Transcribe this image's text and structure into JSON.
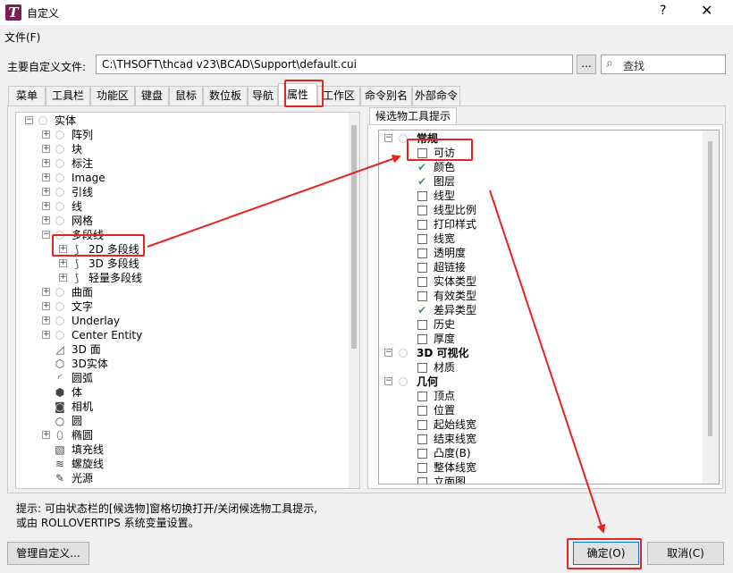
{
  "window": {
    "title": "自定义",
    "help": "?",
    "close": "✕"
  },
  "menu": {
    "file": "文件(F)"
  },
  "path": {
    "label": "主要自定义文件:",
    "value": "C:\\THSOFT\\thcad v23\\BCAD\\Support\\default.cui",
    "browse": "...",
    "search_placeholder": "查找"
  },
  "tabs": [
    "菜单",
    "工具栏",
    "功能区",
    "键盘",
    "鼠标",
    "数位板",
    "导航",
    "属性",
    "工作区",
    "命令别名",
    "外部命令"
  ],
  "active_tab": "属性",
  "left_tree": [
    {
      "label": "实体",
      "expander": "-",
      "icon": "circle"
    },
    {
      "label": "阵列",
      "expander": "+",
      "icon": "circle"
    },
    {
      "label": "块",
      "expander": "+",
      "icon": "circle"
    },
    {
      "label": "标注",
      "expander": "+",
      "icon": "circle"
    },
    {
      "label": "Image",
      "expander": "+",
      "icon": "circle"
    },
    {
      "label": "引线",
      "expander": "+",
      "icon": "circle"
    },
    {
      "label": "线",
      "expander": "+",
      "icon": "circle"
    },
    {
      "label": "网格",
      "expander": "+",
      "icon": "circle"
    },
    {
      "label": "多段线",
      "expander": "-",
      "icon": "circle"
    },
    {
      "label": "2D 多段线",
      "expander": "+",
      "icon": "polyline-icon"
    },
    {
      "label": "3D 多段线",
      "expander": "+",
      "icon": "polyline-icon"
    },
    {
      "label": "轻量多段线",
      "expander": "+",
      "icon": "polyline-icon"
    },
    {
      "label": "曲面",
      "expander": "+",
      "icon": "circle"
    },
    {
      "label": "文字",
      "expander": "+",
      "icon": "circle"
    },
    {
      "label": "Underlay",
      "expander": "+",
      "icon": "circle"
    },
    {
      "label": "Center Entity",
      "expander": "+",
      "icon": "circle"
    },
    {
      "label": "3D 面",
      "expander": "",
      "icon": "3dface-icon"
    },
    {
      "label": "3D实体",
      "expander": "",
      "icon": "3dsolid-icon"
    },
    {
      "label": "圆弧",
      "expander": "",
      "icon": "arc-icon"
    },
    {
      "label": "体",
      "expander": "",
      "icon": "body-icon"
    },
    {
      "label": "相机",
      "expander": "",
      "icon": "camera-icon"
    },
    {
      "label": "圆",
      "expander": "",
      "icon": "circle-icon"
    },
    {
      "label": "椭圆",
      "expander": "+",
      "icon": "ellipse-icon"
    },
    {
      "label": "填充线",
      "expander": "",
      "icon": "hatch-icon"
    },
    {
      "label": "螺旋线",
      "expander": "",
      "icon": "helix-icon"
    },
    {
      "label": "光源",
      "expander": "",
      "icon": "light-icon"
    }
  ],
  "right_tab": "候选物工具提示",
  "right_tree": [
    {
      "label": "常规",
      "kind": "group"
    },
    {
      "label": "可访",
      "kind": "check",
      "checked": false
    },
    {
      "label": "颜色",
      "kind": "check",
      "checked": true
    },
    {
      "label": "图层",
      "kind": "check",
      "checked": true
    },
    {
      "label": "线型",
      "kind": "check",
      "checked": false
    },
    {
      "label": "线型比例",
      "kind": "check",
      "checked": false
    },
    {
      "label": "打印样式",
      "kind": "check",
      "checked": false
    },
    {
      "label": "线宽",
      "kind": "check",
      "checked": false
    },
    {
      "label": "透明度",
      "kind": "check",
      "checked": false
    },
    {
      "label": "超链接",
      "kind": "check",
      "checked": false
    },
    {
      "label": "实体类型",
      "kind": "check",
      "checked": false
    },
    {
      "label": "有效类型",
      "kind": "check",
      "checked": false
    },
    {
      "label": "差异类型",
      "kind": "check",
      "checked": true
    },
    {
      "label": "历史",
      "kind": "check",
      "checked": false
    },
    {
      "label": "厚度",
      "kind": "check",
      "checked": false
    },
    {
      "label": "3D 可视化",
      "kind": "group"
    },
    {
      "label": "材质",
      "kind": "check",
      "checked": false
    },
    {
      "label": "几何",
      "kind": "group"
    },
    {
      "label": "顶点",
      "kind": "check",
      "checked": false
    },
    {
      "label": "位置",
      "kind": "check",
      "checked": false
    },
    {
      "label": "起始线宽",
      "kind": "check",
      "checked": false
    },
    {
      "label": "结束线宽",
      "kind": "check",
      "checked": false
    },
    {
      "label": "凸度(B)",
      "kind": "check",
      "checked": false
    },
    {
      "label": "整体线宽",
      "kind": "check",
      "checked": false
    },
    {
      "label": "立面图",
      "kind": "check",
      "checked": false
    }
  ],
  "hint": {
    "line1": "提示:  可由状态栏的[候选物]窗格切换打开/关闭候选物工具提示,",
    "line2": "或由 ROLLOVERTIPS 系统变量设置。"
  },
  "buttons": {
    "manage": "管理自定义...",
    "ok": "确定(O)",
    "cancel": "取消(C)"
  },
  "colors": {
    "annotation": "#e8231e",
    "check": "#2da44e",
    "app_icon": "#7b1f5a"
  }
}
